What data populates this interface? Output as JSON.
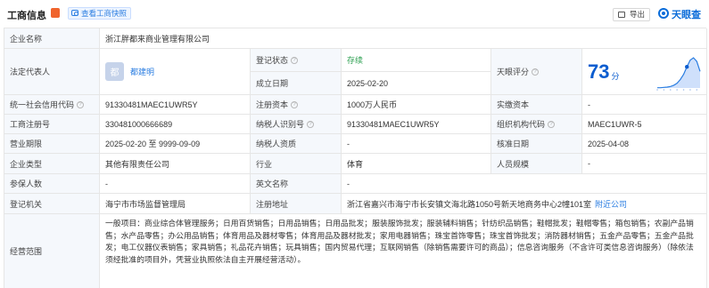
{
  "header": {
    "title": "工商信息",
    "snapshot_label": "查看工商快照",
    "export_label": "导出",
    "brand": "天眼查"
  },
  "rows": {
    "company_name": {
      "label": "企业名称",
      "value": "浙江胖都来商业管理有限公司"
    },
    "legal_rep": {
      "label": "法定代表人",
      "avatar_char": "都",
      "name": "都建明"
    },
    "reg_status": {
      "label": "登记状态",
      "value": "存续"
    },
    "established": {
      "label": "成立日期",
      "value": "2025-02-20"
    },
    "tianyan_score": {
      "label": "天眼评分",
      "value": "73",
      "unit": "分"
    },
    "credit_code": {
      "label": "统一社会信用代码",
      "value": "91330481MAEC1UWR5Y"
    },
    "reg_capital": {
      "label": "注册资本",
      "value": "1000万人民币"
    },
    "paid_capital": {
      "label": "实缴资本",
      "value": "-"
    },
    "reg_number": {
      "label": "工商注册号",
      "value": "330481000666689"
    },
    "taxpayer_id": {
      "label": "纳税人识别号",
      "value": "91330481MAEC1UWR5Y"
    },
    "org_code": {
      "label": "组织机构代码",
      "value": "MAEC1UWR-5"
    },
    "business_term": {
      "label": "营业期限",
      "value": "2025-02-20 至 9999-09-09"
    },
    "taxpayer_qual": {
      "label": "纳税人资质",
      "value": "-"
    },
    "approval_date": {
      "label": "核准日期",
      "value": "2025-04-08"
    },
    "company_type": {
      "label": "企业类型",
      "value": "其他有限责任公司"
    },
    "industry": {
      "label": "行业",
      "value": "体育"
    },
    "staff_size": {
      "label": "人员规模",
      "value": "-"
    },
    "insured": {
      "label": "参保人数",
      "value": "-"
    },
    "english_name": {
      "label": "英文名称",
      "value": "-"
    },
    "registry": {
      "label": "登记机关",
      "value": "海宁市市场监督管理局"
    },
    "address": {
      "label": "注册地址",
      "value": "浙江省嘉兴市海宁市长安镇文海北路1050号新天地商务中心2幢101室",
      "nearby": "附近公司"
    },
    "scope": {
      "label": "经营范围",
      "value": "一般项目：商业综合体管理服务；日用百货销售；日用品销售；日用品批发；服装服饰批发；服装辅料销售；针纺织品销售；鞋帽批发；鞋帽零售；箱包销售；农副产品销售；水产品零售；办公用品销售；体育用品及器材零售；体育用品及器材批发；家用电器销售；珠宝首饰零售；珠宝首饰批发；消防器材销售；五金产品零售；五金产品批发；电工仪器仪表销售；家具销售；礼品花卉销售；玩具销售；国内贸易代理；互联网销售（除销售需要许可的商品）；信息咨询服务（不含许可类信息咨询服务）（除依法须经批准的项目外，凭营业执照依法自主开展经营活动）。"
    }
  },
  "chart_data": {
    "type": "area",
    "values": [
      1,
      1,
      2,
      3,
      5,
      9,
      16,
      28,
      45,
      70,
      92,
      100,
      88,
      55
    ],
    "highlight": "73"
  }
}
